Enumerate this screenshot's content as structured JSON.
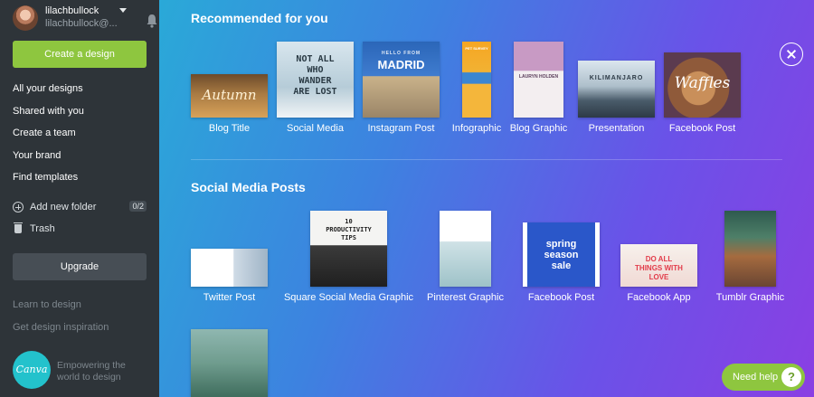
{
  "account": {
    "name": "lilachbullock",
    "email": "lilachbullock@..."
  },
  "sidebar": {
    "create_label": "Create a design",
    "nav": [
      "All your designs",
      "Shared with you",
      "Create a team",
      "Your brand",
      "Find templates"
    ],
    "add_folder_label": "Add new folder",
    "folder_count": "0/2",
    "trash_label": "Trash",
    "upgrade_label": "Upgrade",
    "learn_label": "Learn to design",
    "inspiration_label": "Get design inspiration",
    "logo_text": "Canva",
    "tagline": "Empowering the world to design"
  },
  "recommended": {
    "title": "Recommended for you",
    "items": [
      {
        "label": "Blog Title",
        "thumb_text": "Autumn"
      },
      {
        "label": "Social Media",
        "thumb_text": "NOT ALL WHO WANDER ARE LOST"
      },
      {
        "label": "Instagram Post",
        "thumb_text": "MADRID",
        "thumb_kicker": "HELLO FROM"
      },
      {
        "label": "Infographic",
        "thumb_text": "PET SURVEY"
      },
      {
        "label": "Blog Graphic",
        "thumb_text": "LAURYN HOLDEN"
      },
      {
        "label": "Presentation",
        "thumb_text": "KILIMANJARO"
      },
      {
        "label": "Facebook Post",
        "thumb_text": "Waffles"
      }
    ]
  },
  "social": {
    "title": "Social Media Posts",
    "items": [
      {
        "label": "Twitter Post"
      },
      {
        "label": "Square Social Media Graphic",
        "thumb_text": "10 PRODUCTIVITY TIPS"
      },
      {
        "label": "Pinterest Graphic"
      },
      {
        "label": "Facebook Post",
        "thumb_text": "spring season sale"
      },
      {
        "label": "Facebook App",
        "thumb_text": "DO ALL THINGS WITH LOVE"
      },
      {
        "label": "Tumblr Graphic"
      }
    ]
  },
  "help_label": "Need help",
  "colors": {
    "accent_green": "#8ec63f",
    "sidebar": "#2e3439",
    "gradient_start": "#2aa9d8",
    "gradient_end": "#8a3fe3"
  }
}
